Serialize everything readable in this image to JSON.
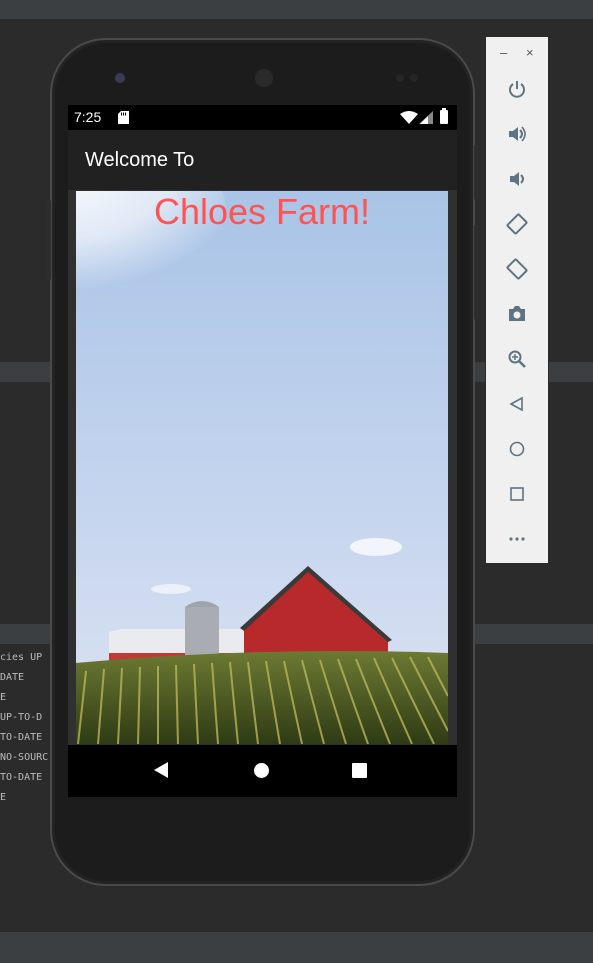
{
  "phone": {
    "status_bar": {
      "time": "7:25"
    },
    "app_bar": {
      "title": "Welcome To"
    },
    "content": {
      "headline": "Chloes Farm!",
      "headline_color": "#ff5252"
    }
  },
  "emulator_toolbar": {
    "window_controls": {
      "minimize": "–",
      "close": "×"
    },
    "buttons": [
      "power-icon",
      "volume-up-icon",
      "volume-down-icon",
      "rotate-left-icon",
      "rotate-right-icon",
      "camera-icon",
      "zoom-icon",
      "back-icon",
      "home-icon",
      "overview-icon",
      "more-icon"
    ]
  },
  "ide_console": {
    "lines": [
      "cies UP",
      "DATE",
      "E",
      " UP-TO-D",
      "TO-DATE",
      "NO-SOURC",
      "TO-DATE",
      "",
      "E"
    ]
  },
  "colors": {
    "accent_red": "#ff5252",
    "app_bar": "#212121",
    "ide_bg": "#2b2b2b",
    "toolbar_bg": "#f0f0f0",
    "icon_color": "#5f7482"
  }
}
